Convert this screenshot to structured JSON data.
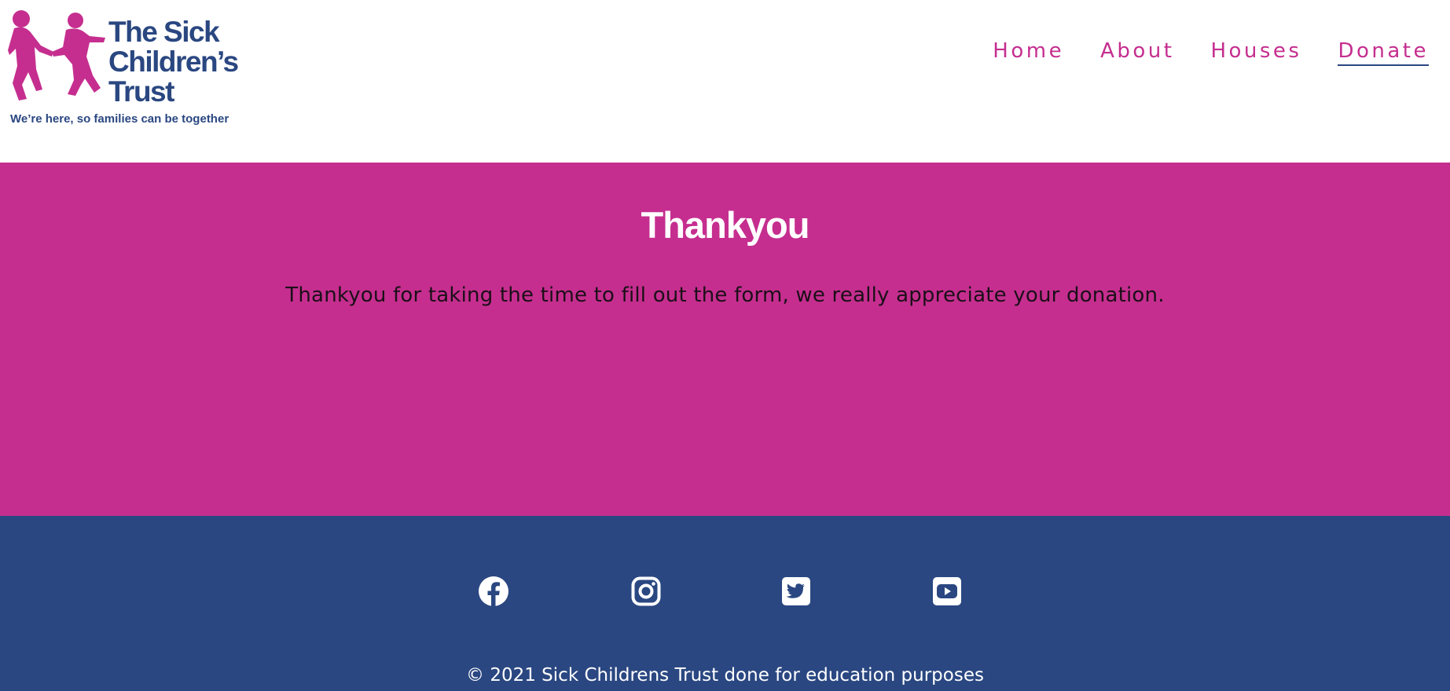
{
  "logo": {
    "title_lines": [
      "The Sick",
      "Children’s",
      "Trust"
    ],
    "tagline": "We’re here, so families can be together",
    "icon": "children-silhouette-icon",
    "colors": {
      "primary": "#2a4781",
      "accent": "#c52e8f"
    }
  },
  "nav": {
    "items": [
      {
        "label": "Home",
        "active": false
      },
      {
        "label": "About",
        "active": false
      },
      {
        "label": "Houses",
        "active": false
      },
      {
        "label": "Donate",
        "active": true
      }
    ]
  },
  "main": {
    "heading": "Thankyou",
    "message": "Thankyou for taking the time to fill out the form, we really appreciate your donation.",
    "background": "#c52e8f"
  },
  "footer": {
    "social_icons": [
      "facebook-icon",
      "instagram-icon",
      "twitter-icon",
      "youtube-icon"
    ],
    "copyright": "© 2021 Sick Childrens Trust done for education purposes",
    "background": "#2a4781"
  }
}
